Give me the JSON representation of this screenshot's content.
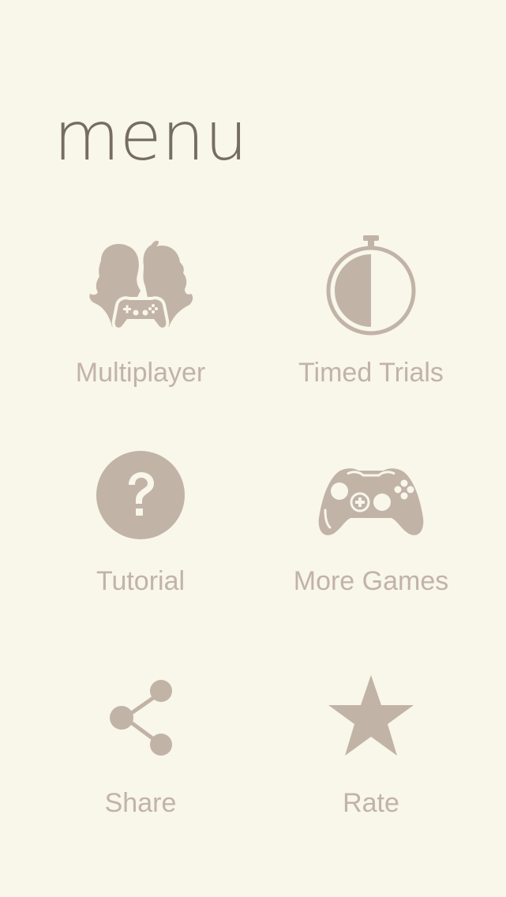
{
  "colors": {
    "background": "#f9f6ea",
    "title": "#756d63",
    "icon": "#c2b3a7",
    "label": "#c2b3a7"
  },
  "page": {
    "title": "menu"
  },
  "menu": {
    "items": [
      {
        "label": "Multiplayer",
        "icon": "multiplayer-icon"
      },
      {
        "label": "Timed Trials",
        "icon": "stopwatch-icon"
      },
      {
        "label": "Tutorial",
        "icon": "question-icon"
      },
      {
        "label": "More Games",
        "icon": "gamepad-icon"
      },
      {
        "label": "Share",
        "icon": "share-icon"
      },
      {
        "label": "Rate",
        "icon": "star-icon"
      }
    ]
  }
}
